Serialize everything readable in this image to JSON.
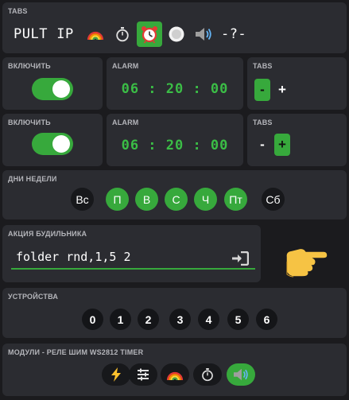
{
  "tabs": {
    "title": "TABS",
    "items": [
      {
        "label": "PULT",
        "icon": null,
        "active": false
      },
      {
        "label": "IP",
        "icon": null,
        "active": false
      },
      {
        "label": "",
        "icon": "rainbow-icon",
        "active": false
      },
      {
        "label": "",
        "icon": "stopwatch-icon",
        "active": false
      },
      {
        "label": "",
        "icon": "alarm-clock-icon",
        "active": true
      },
      {
        "label": "",
        "icon": "record-button-icon",
        "active": false
      },
      {
        "label": "",
        "icon": "speaker-icon",
        "active": false
      },
      {
        "label": "-?-",
        "icon": null,
        "active": false
      }
    ]
  },
  "rows": [
    {
      "enable_title": "ВКЛЮЧИТЬ",
      "enabled": true,
      "alarm_title": "ALARM",
      "time": "06 : 20 : 00",
      "tabs_title": "TABS",
      "minus": "-",
      "plus": "+",
      "selected": "minus"
    },
    {
      "enable_title": "ВКЛЮЧИТЬ",
      "enabled": true,
      "alarm_title": "ALARM",
      "time": "06 : 20 : 00",
      "tabs_title": "TABS",
      "minus": "-",
      "plus": "+",
      "selected": "plus"
    }
  ],
  "weekdays": {
    "title": "ДНИ НЕДЕЛИ",
    "days": [
      {
        "label": "Вс",
        "on": false
      },
      {
        "label": "П",
        "on": true
      },
      {
        "label": "В",
        "on": true
      },
      {
        "label": "С",
        "on": true
      },
      {
        "label": "Ч",
        "on": true
      },
      {
        "label": "Пт",
        "on": true
      },
      {
        "label": "Сб",
        "on": false
      }
    ]
  },
  "action": {
    "title": "АКЦИЯ БУДИЛЬНИКА",
    "value": "folder rnd,1,5 2",
    "submit_icon": "sign-in-icon",
    "pointer_icon": "pointing-hand-icon"
  },
  "devices": {
    "title": "УСТРОЙСТВА",
    "items": [
      "0",
      "1",
      "2",
      "3",
      "4",
      "5",
      "6"
    ]
  },
  "modules": {
    "title": "МОДУЛИ - РЕЛЕ ШИМ WS2812 TIMER",
    "items": [
      {
        "icon": "lightning-icon",
        "on": false
      },
      {
        "icon": "sliders-icon",
        "on": false
      },
      {
        "icon": "rainbow-icon",
        "on": false
      },
      {
        "icon": "stopwatch-icon",
        "on": false
      },
      {
        "icon": "speaker-icon",
        "on": true
      }
    ]
  },
  "colors": {
    "accent": "#37a93c",
    "time": "#3bbd46",
    "card": "#2b2c31",
    "page": "#1b1b1e"
  }
}
